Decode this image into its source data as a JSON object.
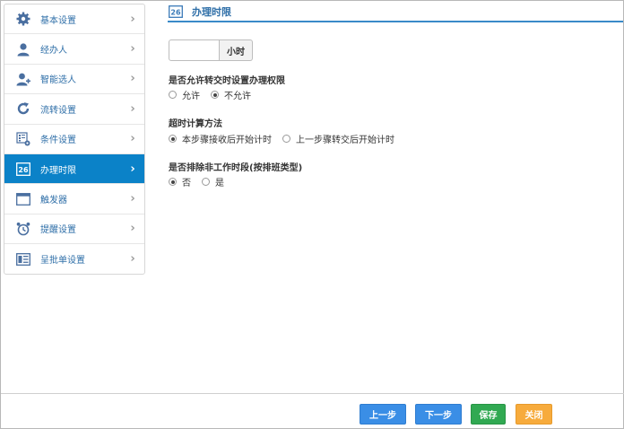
{
  "sidebar": {
    "items": [
      {
        "label": "基本设置",
        "icon": "gear-icon",
        "active": false
      },
      {
        "label": "经办人",
        "icon": "person-icon",
        "active": false
      },
      {
        "label": "智能选人",
        "icon": "person-add-icon",
        "active": false
      },
      {
        "label": "流转设置",
        "icon": "refresh-icon",
        "active": false
      },
      {
        "label": "条件设置",
        "icon": "condition-grid-icon",
        "active": false
      },
      {
        "label": "办理时限",
        "icon": "calendar-26-icon",
        "active": true
      },
      {
        "label": "触发器",
        "icon": "window-icon",
        "active": false
      },
      {
        "label": "提醒设置",
        "icon": "alarm-clock-icon",
        "active": false
      },
      {
        "label": "呈批单设置",
        "icon": "form-icon",
        "active": false
      }
    ],
    "chevron": "›"
  },
  "header": {
    "icon_text": "26",
    "title": "办理时限"
  },
  "hours": {
    "value": "",
    "unit": "小时"
  },
  "q1": {
    "title": "是否允许转交时设置办理权限",
    "options": [
      {
        "label": "允许",
        "checked": false
      },
      {
        "label": "不允许",
        "checked": true
      }
    ]
  },
  "q2": {
    "title": "超时计算方法",
    "options": [
      {
        "label": "本步骤接收后开始计时",
        "checked": true
      },
      {
        "label": "上一步骤转交后开始计时",
        "checked": false
      }
    ]
  },
  "q3": {
    "title": "是否排除非工作时段(按排班类型)",
    "options": [
      {
        "label": "否",
        "checked": true
      },
      {
        "label": "是",
        "checked": false
      }
    ]
  },
  "footer": {
    "prev": "上一步",
    "next": "下一步",
    "save": "保存",
    "close": "关闭"
  },
  "colors": {
    "active_bg": "#0b82c8",
    "blue_btn": "#3a8ee6",
    "green_btn": "#31a952",
    "orange_btn": "#f7ab3c"
  }
}
